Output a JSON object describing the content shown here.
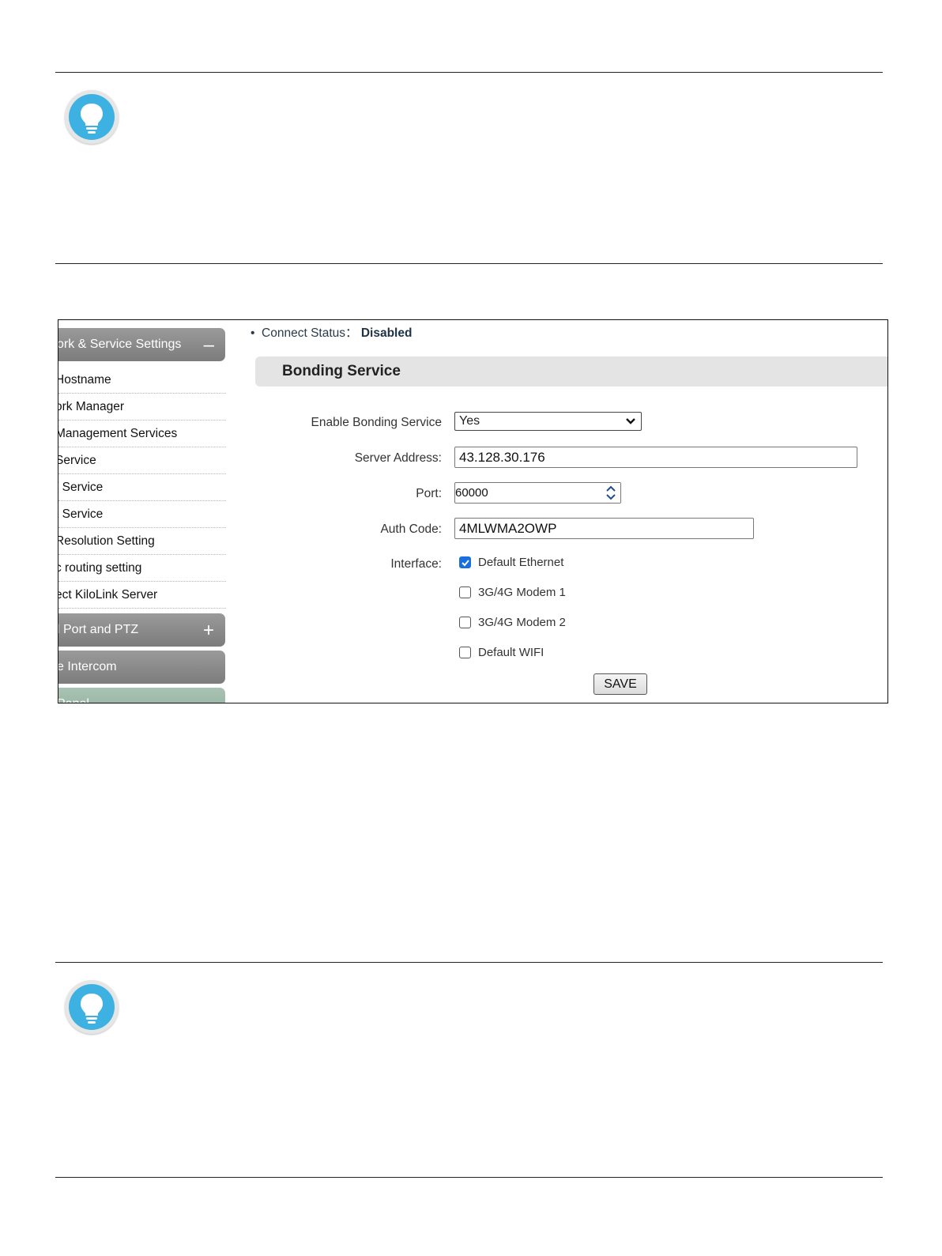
{
  "sidebar": {
    "headers": [
      {
        "label": "ork & Service Settings",
        "toggle": "–"
      },
      {
        "label": "l Port and PTZ",
        "toggle": "+"
      },
      {
        "label": "e Intercom",
        "toggle": ""
      },
      {
        "label": "Panel",
        "toggle": ""
      }
    ],
    "items": [
      {
        "label": "Hostname"
      },
      {
        "label": "ork Manager"
      },
      {
        "label": " Management Services"
      },
      {
        "label": "Service"
      },
      {
        "label": "/ Service"
      },
      {
        "label": "t Service"
      },
      {
        "label": " Resolution Setting"
      },
      {
        "label": "c routing setting"
      },
      {
        "label": "ect KiloLink Server"
      }
    ]
  },
  "status": {
    "label": "Connect Status：",
    "value": "Disabled"
  },
  "section": {
    "title": "Bonding Service"
  },
  "form": {
    "enable_label": "Enable Bonding Service",
    "enable_value": "Yes",
    "server_label": "Server Address:",
    "server_value": "43.128.30.176",
    "port_label": "Port:",
    "port_value": "60000",
    "auth_label": "Auth Code:",
    "auth_value": "4MLWMA2OWP",
    "interface_label": "Interface:",
    "interfaces": [
      {
        "label": "Default Ethernet",
        "checked": true
      },
      {
        "label": "3G/4G Modem 1",
        "checked": false
      },
      {
        "label": "3G/4G Modem 2",
        "checked": false
      },
      {
        "label": "Default WIFI",
        "checked": false
      }
    ],
    "save_label": "SAVE"
  },
  "colors": {
    "tip_icon": "#3db1e2",
    "sidebar_header": "#8a8a8a",
    "checkbox_on": "#1a6fe0"
  }
}
